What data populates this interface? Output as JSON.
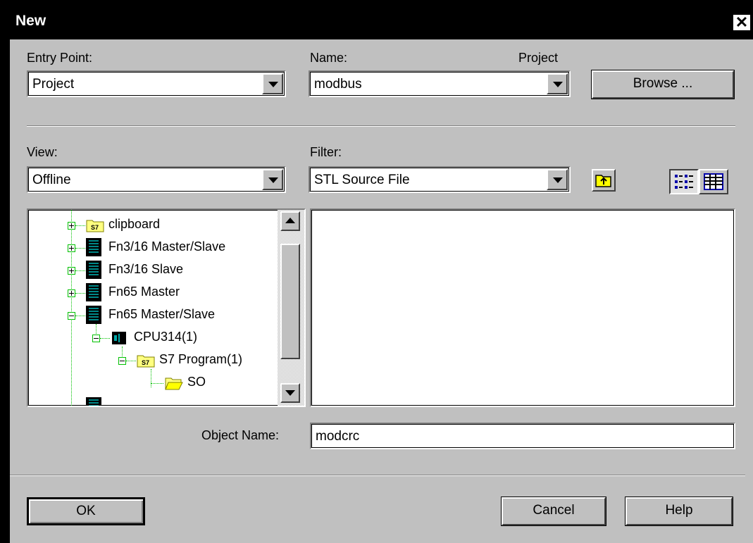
{
  "window": {
    "title": "New"
  },
  "entry_point": {
    "label": "Entry Point:",
    "value": "Project"
  },
  "name": {
    "label": "Name:",
    "value": "modbus",
    "type_label": "Project"
  },
  "browse_button": "Browse ...",
  "view": {
    "label": "View:",
    "value": "Offline"
  },
  "filter": {
    "label": "Filter:",
    "value": "STL Source File"
  },
  "tree": {
    "items": [
      {
        "label": "clipboard",
        "icon": "s7-folder-icon"
      },
      {
        "label": "Fn3/16 Master/Slave",
        "icon": "station-icon"
      },
      {
        "label": "Fn3/16 Slave",
        "icon": "station-icon"
      },
      {
        "label": "Fn65 Master",
        "icon": "station-icon"
      },
      {
        "label": "Fn65 Master/Slave",
        "icon": "station-icon"
      },
      {
        "label": "CPU314(1)",
        "icon": "cpu-icon"
      },
      {
        "label": "S7 Program(1)",
        "icon": "s7-folder-icon"
      },
      {
        "label": "SO",
        "icon": "open-folder-icon"
      }
    ]
  },
  "object_name": {
    "label": "Object Name:",
    "value": "modcrc"
  },
  "ok_button": "OK",
  "cancel_button": "Cancel",
  "help_button": "Help"
}
